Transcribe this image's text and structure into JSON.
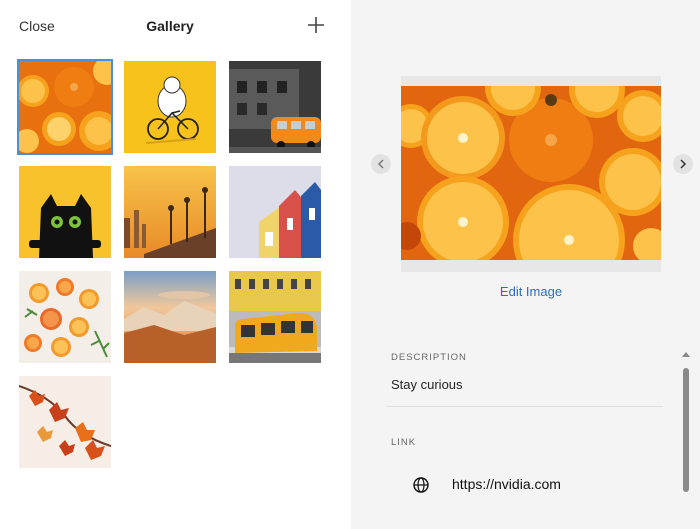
{
  "header": {
    "close_label": "Close",
    "title": "Gallery",
    "add_icon": "plus-icon"
  },
  "gallery": {
    "thumbnails": [
      {
        "name": "orange-slices"
      },
      {
        "name": "cat-bicycle"
      },
      {
        "name": "street-bus"
      },
      {
        "name": "black-cat"
      },
      {
        "name": "boardwalk-sunset"
      },
      {
        "name": "colorful-houses"
      },
      {
        "name": "citrus-wheels"
      },
      {
        "name": "mountain-sunrise"
      },
      {
        "name": "yellow-tram"
      },
      {
        "name": "autumn-leaves"
      }
    ],
    "selected_index": 0
  },
  "preview": {
    "edit_label": "Edit Image"
  },
  "details": {
    "description_label": "DESCRIPTION",
    "description_value": "Stay curious",
    "link_label": "LINK",
    "link_value": "https://nvidia.com"
  },
  "colors": {
    "accent": "#2a6ebf",
    "selected_outline": "#4a90d9",
    "panel_bg": "#f4f4f4"
  }
}
